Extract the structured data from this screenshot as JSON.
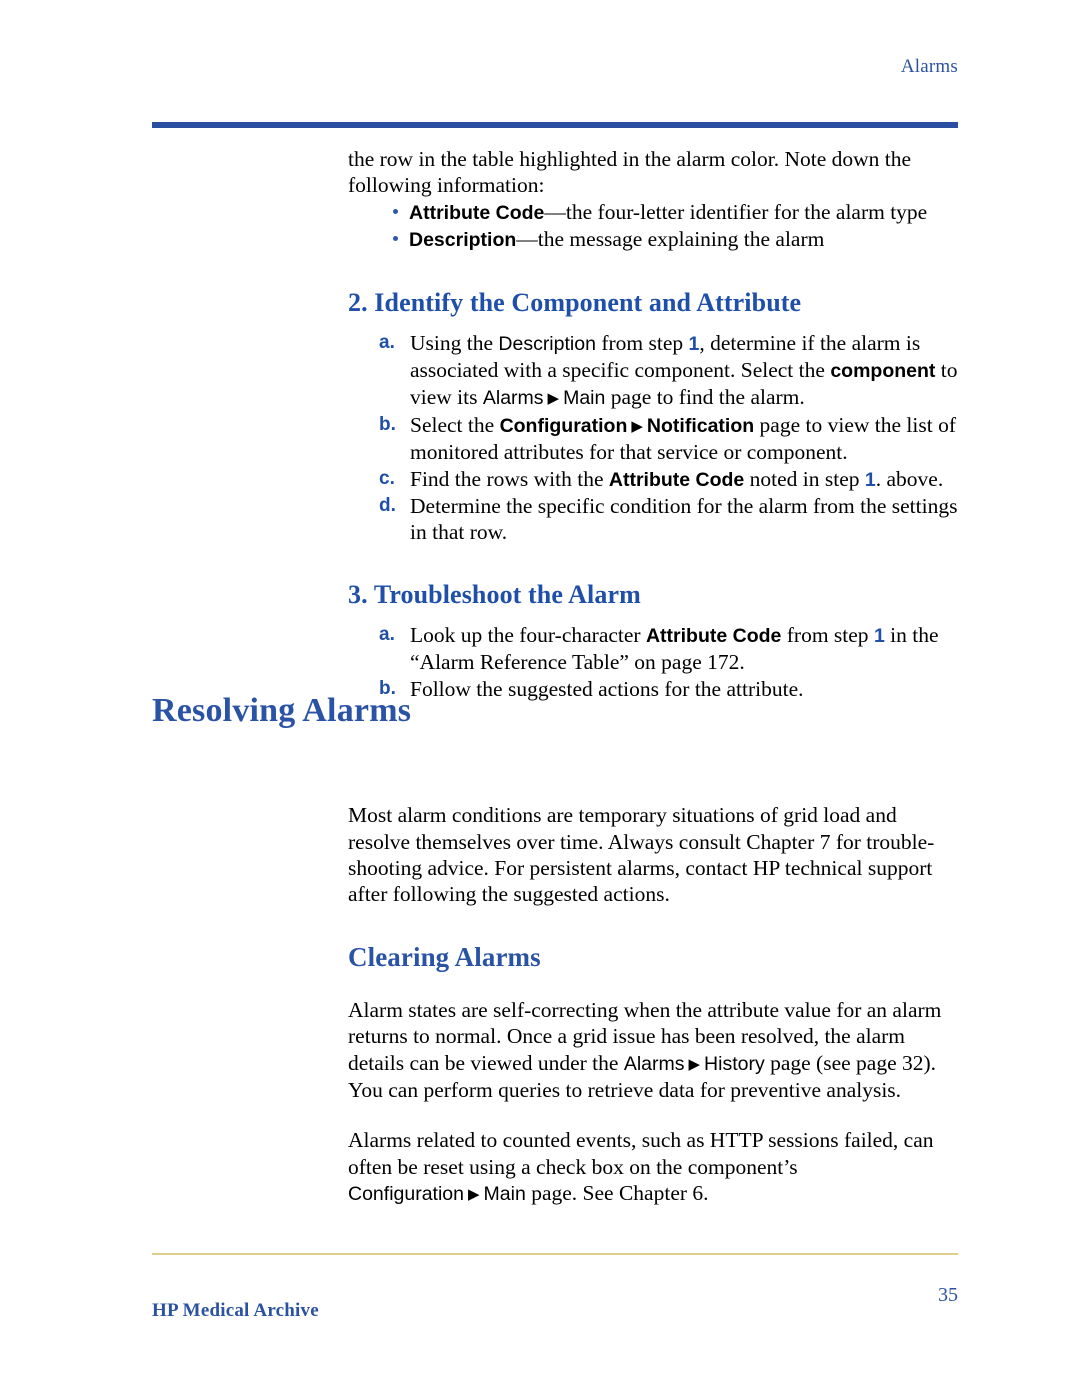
{
  "header": {
    "running_title": "Alarms",
    "rule_color": "#2a4fa0"
  },
  "intro": {
    "line1": "the row in the table highlighted in the alarm color. Note down",
    "line2": "the following information:"
  },
  "intro_bullets": [
    {
      "term": "Attribute Code",
      "dash": "—",
      "rest": "the four-letter identifier for the alarm type"
    },
    {
      "term": "Description",
      "dash": "—",
      "rest": "the message explaining the alarm"
    }
  ],
  "step2": {
    "heading": "2. Identify the Component and Attribute",
    "items": [
      {
        "marker": "a.",
        "t1": "Using the ",
        "ui1": "Description",
        "t2": " from step ",
        "num": "1",
        "t3": ", determine if the alarm is associated with a specific component. Select the ",
        "uib1": "component",
        "t4": " to view its ",
        "ui2": "Alarms",
        "arrow": "▶",
        "ui3": "Main",
        "t5": " page to find the alarm."
      },
      {
        "marker": "b.",
        "t1": "Select the ",
        "uib1": "Configuration",
        "arrow": "▶",
        "uib2": "Notification",
        "t2": " page to view the list of monitored attributes for that service or component."
      },
      {
        "marker": "c.",
        "t1": "Find the rows with the ",
        "uib1": "Attribute Code",
        "t2": " noted in step ",
        "num": "1",
        "t3": ". above."
      },
      {
        "marker": "d.",
        "t1": "Determine the specific condition for the alarm from the settings in that row."
      }
    ]
  },
  "step3": {
    "heading": "3. Troubleshoot the Alarm",
    "items": [
      {
        "marker": "a.",
        "t1": "Look up the four-character ",
        "uib1": "Attribute Code",
        "t2": " from step ",
        "num": "1",
        "t3": " in the “Alarm Reference Table” on page 172."
      },
      {
        "marker": "b.",
        "t1": "Follow the suggested actions for the attribute."
      }
    ]
  },
  "section": {
    "title": "Resolving Alarms",
    "paragraph": "Most alarm conditions are temporary situations of grid load and resolve themselves over time. Always consult Chapter 7 for trouble-shooting advice. For persistent alarms, contact HP technical support after following the suggested actions."
  },
  "subsection": {
    "title": "Clearing Alarms",
    "para1_a": "Alarm states are self-correcting when the attribute value for an alarm returns to normal. Once a grid issue has been resolved, the alarm details can be viewed under the ",
    "para1_ui1": "Alarms",
    "para1_arrow": "▶",
    "para1_ui2": "History",
    "para1_b": " page (see page 32). You can perform queries to retrieve data for preventive analysis.",
    "para2_a": "Alarms related to counted events, such as HTTP sessions failed, can often be reset using a check box on the component’s ",
    "para2_ui1": "Configuration",
    "para2_arrow": "▶",
    "para2_ui2": "Main",
    "para2_b": " page. See Chapter 6."
  },
  "footer": {
    "left_label": "HP Medical Archive",
    "page_number": "35",
    "rule_color": "#e0ce8e"
  },
  "colors": {
    "heading_blue": "#2a52a5",
    "accent_blue": "#1f4fa8",
    "rule_blue": "#2a4fa0",
    "gold": "#e0ce8e"
  }
}
